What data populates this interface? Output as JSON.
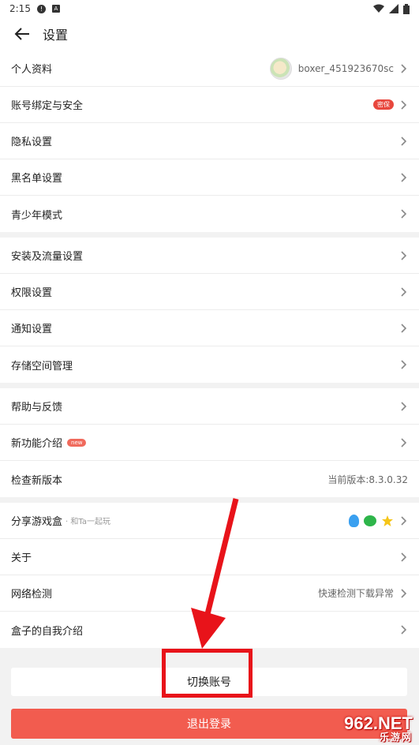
{
  "status_bar": {
    "time": "2:15",
    "icon_alert": "!",
    "icon_a": "A"
  },
  "header": {
    "title": "设置"
  },
  "groups": [
    {
      "rows": [
        {
          "label": "个人资料",
          "right_text": "boxer_451923670sc"
        },
        {
          "label": "账号绑定与安全",
          "badge": "密保"
        },
        {
          "label": "隐私设置"
        },
        {
          "label": "黑名单设置"
        },
        {
          "label": "青少年模式"
        }
      ]
    },
    {
      "rows": [
        {
          "label": "安装及流量设置"
        },
        {
          "label": "权限设置"
        },
        {
          "label": "通知设置"
        },
        {
          "label": "存储空间管理"
        }
      ]
    },
    {
      "rows": [
        {
          "label": "帮助与反馈"
        },
        {
          "label": "新功能介绍",
          "badge": "new"
        },
        {
          "label": "检查新版本",
          "right_text": "当前版本:8.3.0.32"
        }
      ]
    },
    {
      "rows": [
        {
          "label": "分享游戏盒",
          "sub": "· 和Ta一起玩"
        },
        {
          "label": "关于"
        },
        {
          "label": "网络检测",
          "right_text": "快速检测下载异常"
        },
        {
          "label": "盒子的自我介绍"
        }
      ]
    }
  ],
  "buttons": {
    "switch_account": "切换账号",
    "logout": "退出登录"
  },
  "watermark": {
    "brand": "962.NET",
    "sub": "乐游网"
  },
  "colors": {
    "accent": "#f25c4f",
    "annotation": "#e8131a",
    "badge_red": "#e8473d"
  },
  "icons": {
    "share": [
      "qq-icon",
      "wechat-icon",
      "star-icon"
    ]
  }
}
